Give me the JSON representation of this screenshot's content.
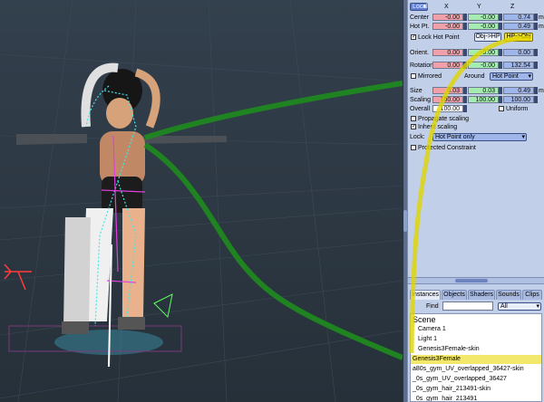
{
  "viewport": {
    "name": "3D scene viewport"
  },
  "panel": {
    "coord_mode": "Local",
    "axes": [
      "X",
      "Y",
      "Z"
    ],
    "center": {
      "label": "Center",
      "x": "-0.00",
      "y": "-0.00",
      "z": "0.74",
      "unit": "m"
    },
    "hotpt": {
      "label": "Hot Pt.",
      "x": "-0.00",
      "y": "-0.00",
      "z": "0.49",
      "unit": "m"
    },
    "lock_hot_point": "Lock Hot Point",
    "obj_hp": "Obj->HP",
    "hp_obj": "HP->Obj",
    "orient": {
      "label": "Orient.",
      "x": "0.00",
      "y": "-0.00",
      "z": "0.00"
    },
    "rotation": {
      "label": "Rotation",
      "x": "0.00",
      "y": "-0.00",
      "z": "132.54"
    },
    "mirrored": "Mirrored",
    "around_label": "Around",
    "around_value": "Hot Point",
    "size": {
      "label": "Size",
      "x": "0.03",
      "y": "0.03",
      "z": "0.49",
      "unit": "m"
    },
    "scaling": {
      "label": "Scaling",
      "x": "100.00",
      "y": "100.00",
      "z": "100.00"
    },
    "overall": {
      "label": "Overall",
      "value": "100.00"
    },
    "uniform": "Uniform",
    "propagate_scaling": "Propagate scaling",
    "inherit_scaling": "Inherit scaling",
    "lock_label": "Lock:",
    "lock_value": "Hot Point only",
    "protected_constraint": "Protected Constraint"
  },
  "tabs": [
    "Instances",
    "Objects",
    "Shaders",
    "Sounds",
    "Clips"
  ],
  "find": {
    "label": "Find",
    "value": "",
    "filter": "All"
  },
  "scene": {
    "title": "Scene",
    "items": [
      "Camera 1",
      "Light 1",
      "Genesis3Female-skin",
      "Genesis3Female",
      "a80s_gym_UV_overlapped_36427-skin",
      "_0s_gym_UV_overlapped_36427",
      "_0s_gym_hair_213491-skin",
      "_0s_gym_hair_213491"
    ],
    "selected_index": 3
  },
  "colors": {
    "selection": "#f2e86c",
    "accent": "#f2e23c"
  }
}
